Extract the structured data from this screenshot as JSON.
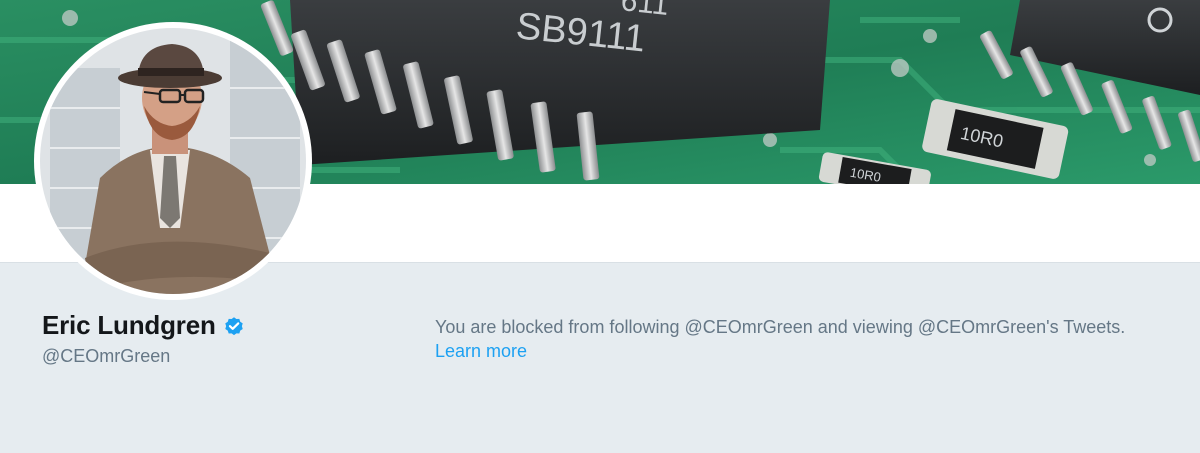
{
  "profile": {
    "display_name": "Eric Lundgren",
    "screen_name": "@CEOmrGreen",
    "verified": true
  },
  "banner": {
    "chip_label_main": "SB9111",
    "chip_label_top": "611",
    "resistor_label": "10R0",
    "resistor_label_small": "10R0"
  },
  "blocked": {
    "message": "You are blocked from following @CEOmrGreen and viewing @CEOmrGreen's Tweets.",
    "learn_more_label": "Learn more"
  },
  "colors": {
    "page_background": "#e6ecf0",
    "link": "#1da1f2",
    "verified_badge": "#1da1f2",
    "text_primary": "#14171a",
    "text_secondary": "#657786",
    "pcb_green": "#1f8a5a"
  },
  "icons": {
    "verified": "verified-badge-icon"
  }
}
